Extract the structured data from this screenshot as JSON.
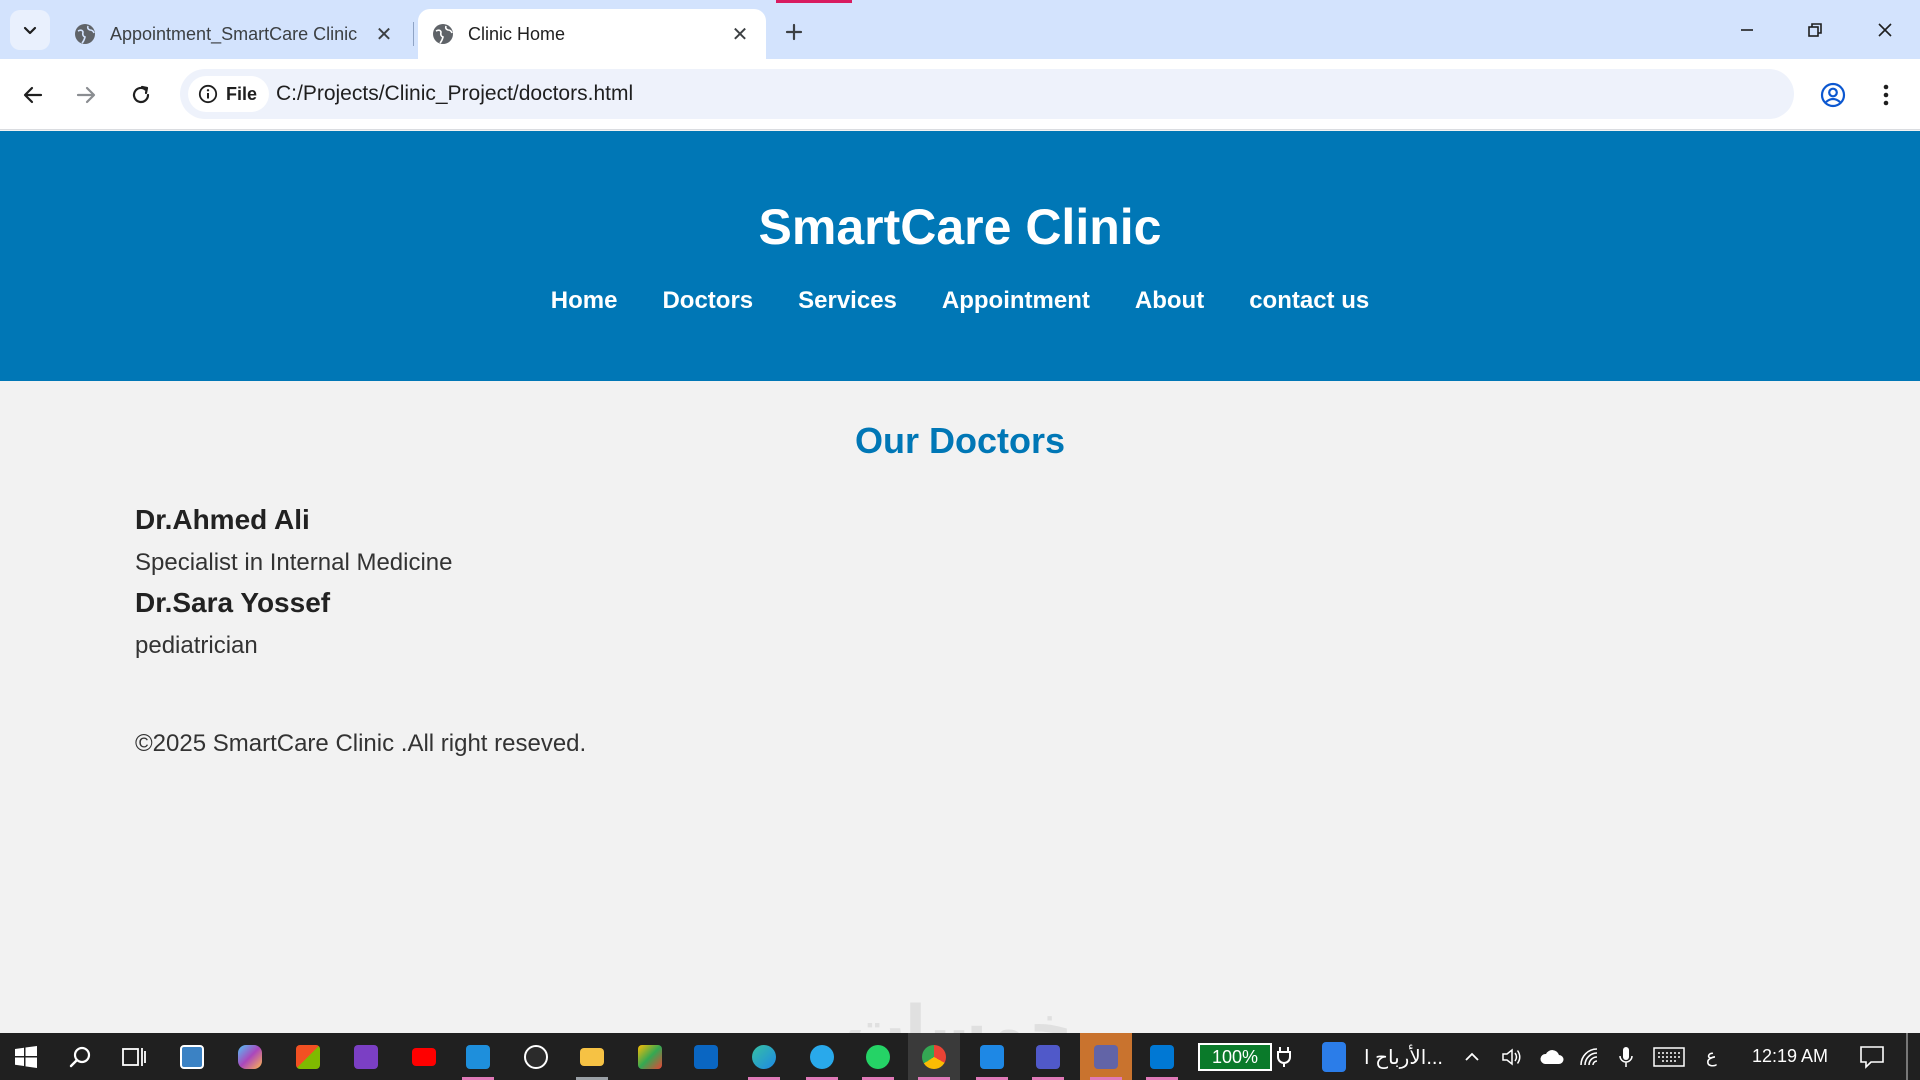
{
  "browser": {
    "tabs": [
      {
        "title": "Appointment_SmartCare Clinic",
        "active": false
      },
      {
        "title": "Clinic Home",
        "active": true
      }
    ],
    "site_chip_label": "File",
    "url": "C:/Projects/Clinic_Project/doctors.html",
    "icons": {
      "tab_search": "chevron-down-icon",
      "favicon": "globe-icon",
      "close": "close-icon",
      "new_tab": "plus-icon",
      "back": "arrow-left-icon",
      "forward": "arrow-right-icon",
      "reload": "reload-icon",
      "info": "info-icon",
      "bookmark": "star-icon",
      "profile": "profile-icon",
      "menu": "kebab-menu-icon"
    }
  },
  "site": {
    "title": "SmartCare Clinic",
    "nav": [
      "Home",
      "Doctors",
      "Services",
      "Appointment",
      "About",
      "contact us"
    ],
    "colors": {
      "header_bg": "#0077b6",
      "accent": "#0077b6",
      "page_bg": "#f2f2f2"
    }
  },
  "doctors_section": {
    "title": "Our Doctors",
    "doctors": [
      {
        "name": "Dr.Ahmed Ali",
        "specialty": "Specialist in Internal Medicine"
      },
      {
        "name": "Dr.Sara Yossef",
        "specialty": "pediatrician"
      }
    ]
  },
  "footer": {
    "text": "©2025 SmartCare Clinic .All right reseved."
  },
  "taskbar": {
    "battery_label": "100%",
    "pinned_app_label": "الأرباح ا...",
    "input_language": "ع",
    "clock": "12:19 AM",
    "watermark": "خمسات"
  }
}
